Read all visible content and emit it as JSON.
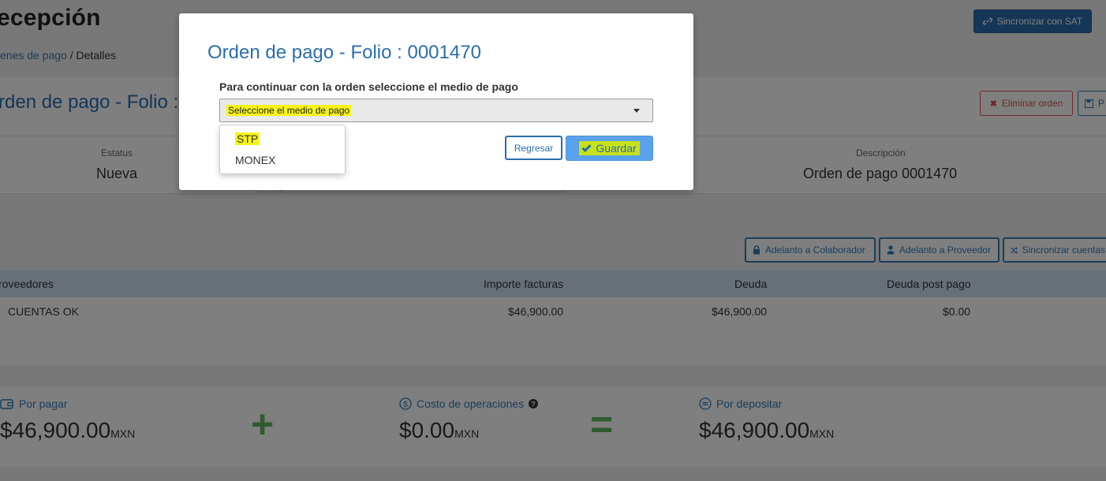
{
  "page": {
    "title": "ecepción",
    "breadcrumb": {
      "link": "enes de pago",
      "separator": " / ",
      "current": "Detalles"
    },
    "sync_sat_label": "Sincronizar con SAT",
    "order_title": "rden de pago - Folio :",
    "delete_label": "Eliminar orden",
    "pdf_label": "P",
    "status_label": "Estatus",
    "status_value": "Nueva",
    "description_label": "Descripción",
    "description_value": "Orden de pago 0001470",
    "actions": {
      "advance_collaborator": "Adelanto a Colaborador",
      "advance_supplier": "Adelanto a Proveedor",
      "sync_accounts": "Sincronizar cuentas"
    },
    "table": {
      "headers": [
        "roveedores",
        "Importe facturas",
        "Deuda",
        "Deuda post pago"
      ],
      "rows": [
        [
          "CUENTAS OK",
          "$46,900.00",
          "$46,900.00",
          "$0.00"
        ]
      ]
    },
    "summary": {
      "to_pay_label": "Por pagar",
      "to_pay_value": "$46,900.00",
      "ops_cost_label": "Costo de operaciones",
      "ops_cost_value": "$0.00",
      "to_deposit_label": "Por depositar",
      "to_deposit_value": "$46,900.00",
      "currency": "MXN",
      "plus": "+",
      "equals": "="
    }
  },
  "modal": {
    "title": "Orden de pago - Folio : 0001470",
    "prompt": "Para continuar con la orden seleccione el medio de pago",
    "select_placeholder": "Seleccione el medio de pago",
    "options": [
      "STP",
      "MONEX"
    ],
    "back_label": "Regresar",
    "save_label": "Guardar"
  },
  "colors": {
    "primary": "#2a6dad",
    "danger": "#d9534f",
    "success": "#5cb85c",
    "highlight": "#f7f41a"
  }
}
